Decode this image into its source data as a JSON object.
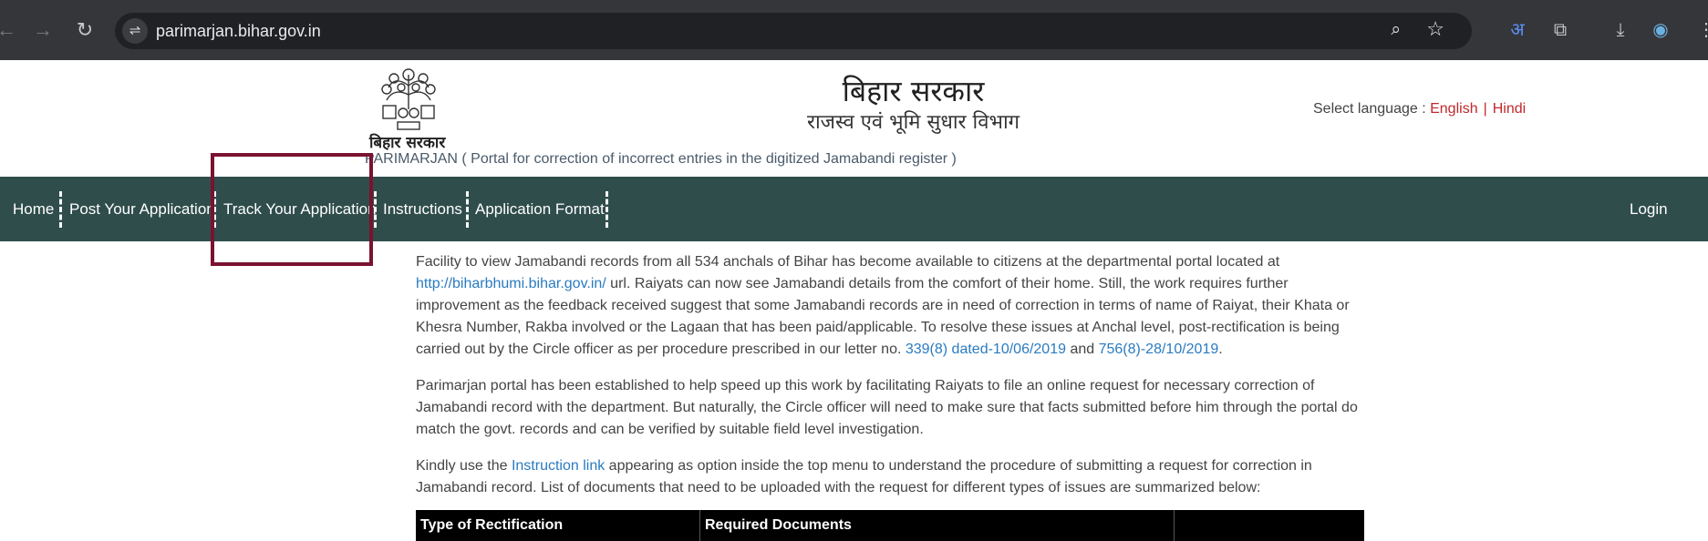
{
  "browser": {
    "url": "parimarjan.bihar.gov.in",
    "back_glyph": "←",
    "forward_glyph": "→",
    "reload_glyph": "↻",
    "site_info_glyph": "⇌",
    "zoom_glyph": "⌕",
    "star_glyph": "☆",
    "translate_glyph": "अ",
    "extensions_glyph": "⧉",
    "download_glyph": "⤓",
    "profile_glyph": "◉",
    "menu_glyph": "⋮"
  },
  "header": {
    "emblem_caption": "बिहार सरकार",
    "gov_title": "बिहार सरकार",
    "dept_title": "राजस्व एवं भूमि सुधार विभाग",
    "portal_subtitle": "PARIMARJAN ( Portal for correction of incorrect entries in the digitized Jamabandi register )",
    "language": {
      "label": "Select language :",
      "english": "English",
      "separator": "|",
      "hindi": "Hindi"
    }
  },
  "nav": {
    "home": "Home",
    "post": "Post Your Application",
    "track": "Track Your Application",
    "instructions": "Instructions",
    "format": "Application Format",
    "login": "Login"
  },
  "content": {
    "p1_a": "Facility to view Jamabandi records from all 534 anchals of Bihar has become available to citizens at the departmental portal located at",
    "p1_link": "http://biharbhumi.bihar.gov.in/",
    "p1_b": " url. Raiyats can now see Jamabandi details from the comfort of their home. Still, the work requires further improvement as the feedback received suggest that some Jamabandi records are in need of correction in terms of name of Raiyat, their Khata or Khesra Number, Rakba involved or the Lagaan that has been paid/applicable. To resolve these issues at Anchal level, post-rectification is being carried out by the Circle officer as per procedure prescribed in our letter no. ",
    "p1_letter1": "339(8) dated-10/06/2019",
    "p1_and": " and ",
    "p1_letter2": "756(8)-28/10/2019",
    "p1_end": ".",
    "p2": "Parimarjan portal has been established to help speed up this work by facilitating Raiyats to file an online request for necessary correction of Jamabandi record with the department. But naturally, the Circle officer will need to make sure that facts submitted before him through the portal do match the govt. records and can be verified by suitable field level investigation.",
    "p3_a": "Kindly use the ",
    "p3_link": "Instruction link",
    "p3_b": " appearing as option inside the top menu to understand the procedure of submitting a request for correction in Jamabandi record. List of documents that need to be uploaded with the request for different types of issues are summarized below:"
  },
  "table": {
    "headers": [
      "Type of Rectification",
      "Required Documents",
      ""
    ]
  },
  "colors": {
    "navbar": "#2f4d4b",
    "link": "#2a7bc0",
    "language_link": "#c0282d",
    "highlight": "#7a1230"
  }
}
